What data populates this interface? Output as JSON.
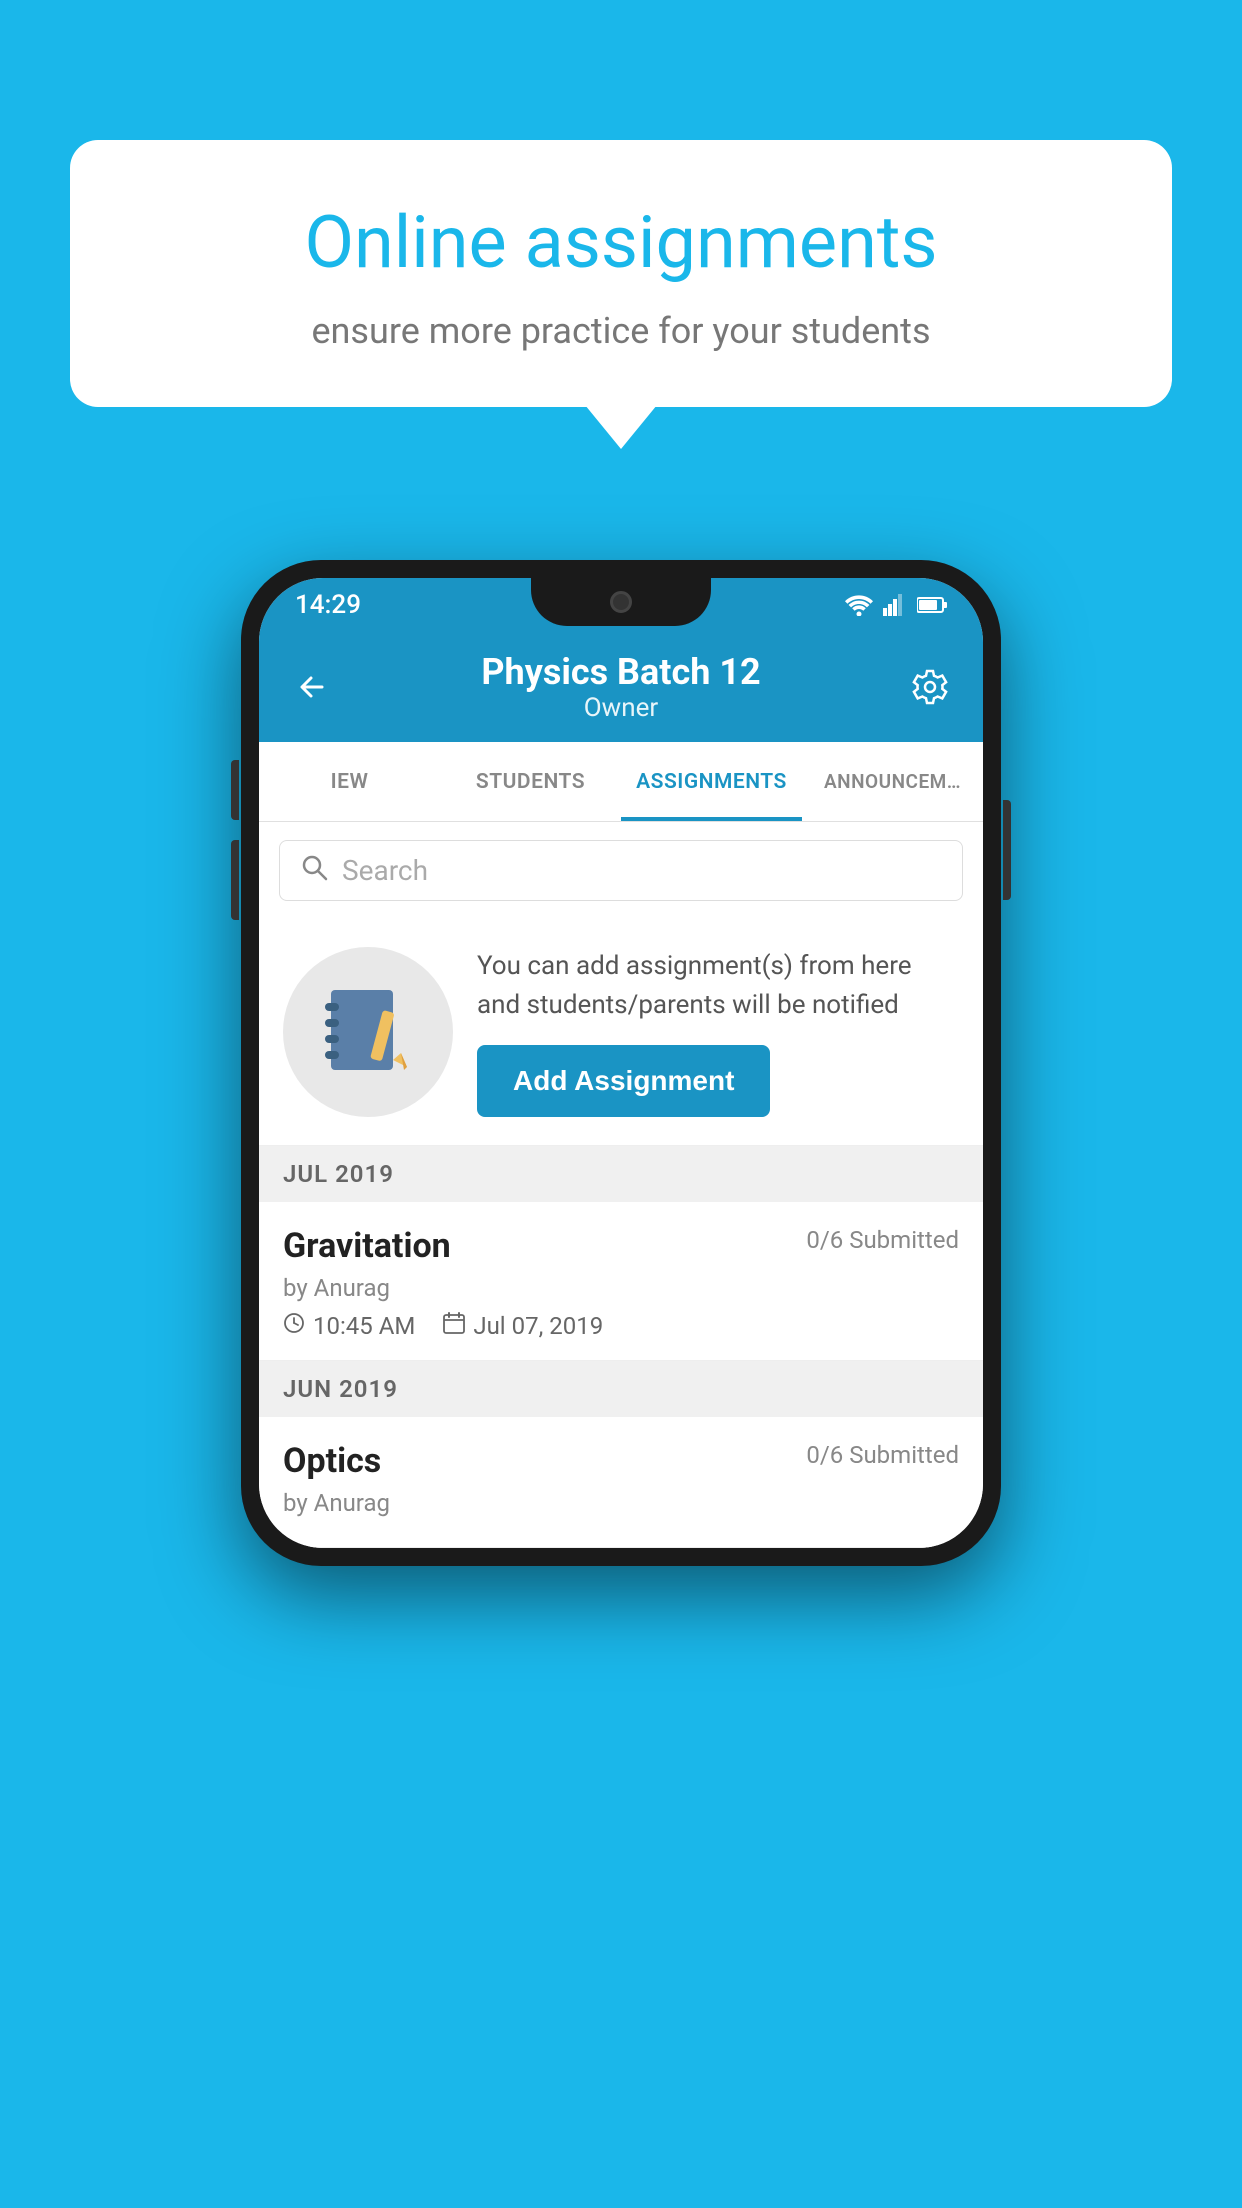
{
  "background_color": "#1ab7ea",
  "speech_bubble": {
    "title": "Online assignments",
    "subtitle": "ensure more practice for your students"
  },
  "status_bar": {
    "time": "14:29",
    "wifi": "wifi",
    "signal": "signal",
    "battery": "battery"
  },
  "app_bar": {
    "back_label": "←",
    "title": "Physics Batch 12",
    "subtitle": "Owner",
    "settings_icon": "⚙"
  },
  "tabs": [
    {
      "label": "IEW",
      "active": false
    },
    {
      "label": "STUDENTS",
      "active": false
    },
    {
      "label": "ASSIGNMENTS",
      "active": true
    },
    {
      "label": "ANNOUNCEM…",
      "active": false
    }
  ],
  "search": {
    "placeholder": "Search"
  },
  "info_card": {
    "icon": "📓",
    "description": "You can add assignment(s) from here and students/parents will be notified",
    "button_label": "Add Assignment"
  },
  "sections": [
    {
      "month": "JUL 2019",
      "assignments": [
        {
          "title": "Gravitation",
          "submitted": "0/6 Submitted",
          "author": "by Anurag",
          "time": "10:45 AM",
          "date": "Jul 07, 2019"
        }
      ]
    },
    {
      "month": "JUN 2019",
      "assignments": [
        {
          "title": "Optics",
          "submitted": "0/6 Submitted",
          "author": "by Anurag",
          "time": "",
          "date": ""
        }
      ]
    }
  ]
}
